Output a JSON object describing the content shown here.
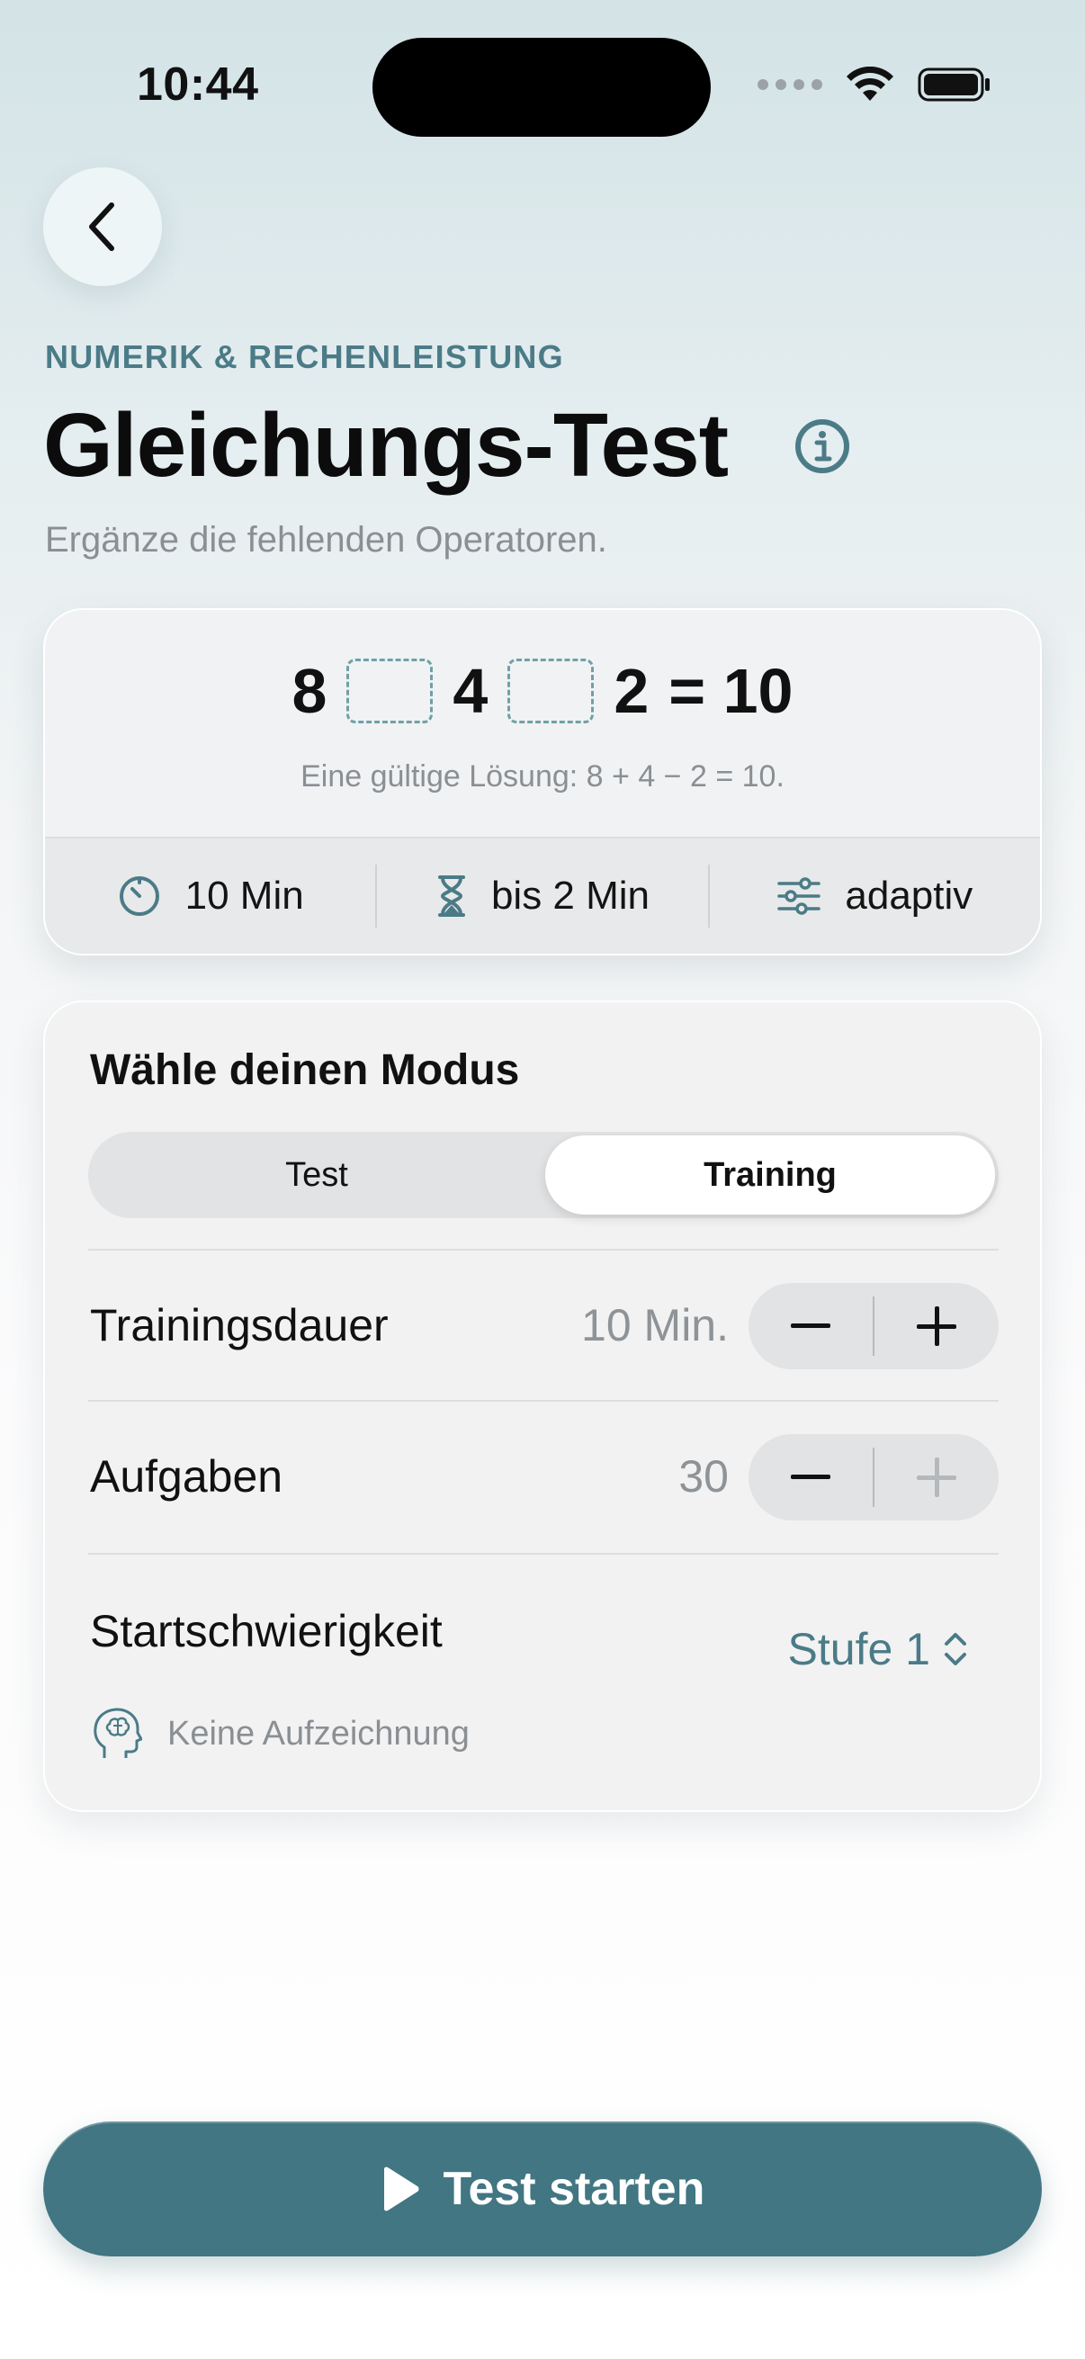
{
  "status_bar": {
    "time": "10:44"
  },
  "header": {
    "category": "NUMERIK & RECHENLEISTUNG",
    "title": "Gleichungs-Test",
    "subtitle": "Ergänze die fehlenden Operatoren."
  },
  "example": {
    "numbers": [
      "8",
      "4",
      "2"
    ],
    "result": "= 10",
    "hint": "Eine gültige Lösung: 8 + 4 − 2 = 10.",
    "meta": {
      "duration": "10 Min",
      "time_per_task": "bis 2 Min",
      "difficulty": "adaptiv"
    }
  },
  "mode": {
    "title": "Wähle deinen Modus",
    "options": [
      "Test",
      "Training"
    ],
    "selected": "Training",
    "rows": {
      "training_duration": {
        "label": "Trainingsdauer",
        "value": "10 Min."
      },
      "tasks": {
        "label": "Aufgaben",
        "value": "30"
      },
      "start_difficulty": {
        "label": "Startschwierigkeit",
        "value": "Stufe 1"
      }
    },
    "note": "Keine Aufzeichnung"
  },
  "start_button": {
    "label": "Test starten"
  },
  "colors": {
    "accent": "#417682",
    "accent_text": "#4b7b87",
    "muted_text": "#8a8f93"
  }
}
